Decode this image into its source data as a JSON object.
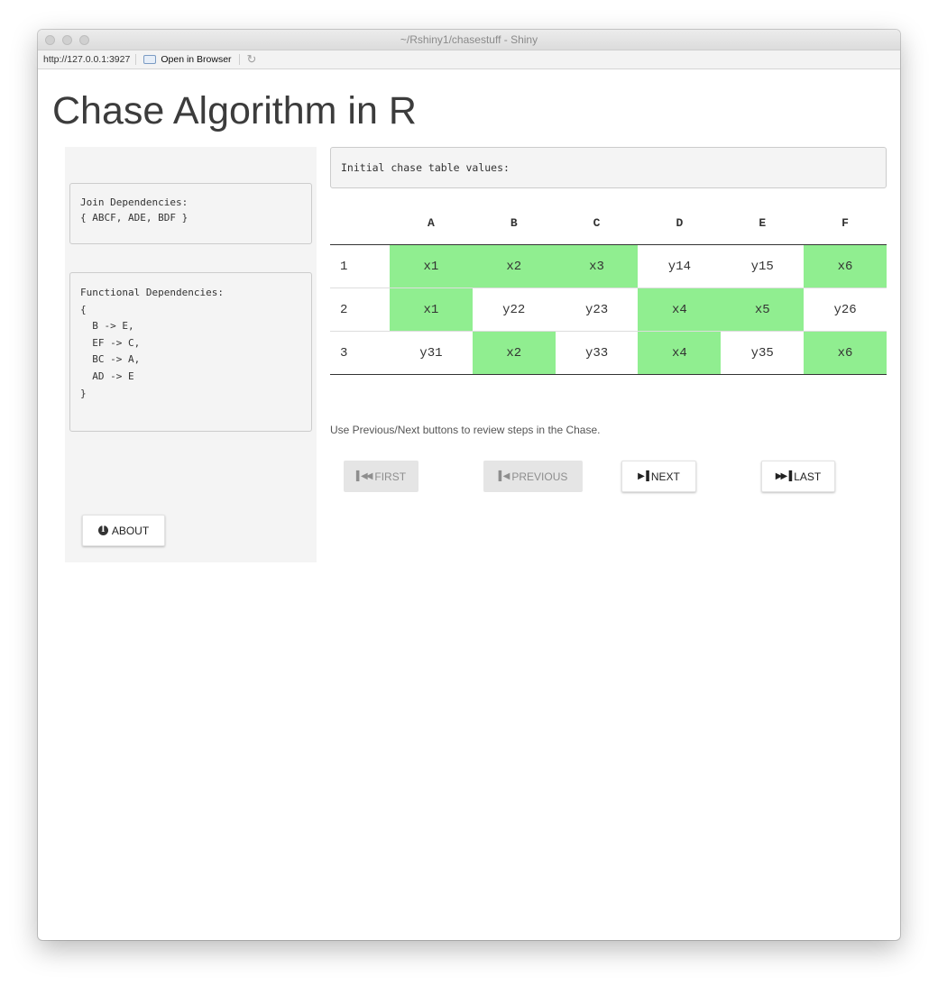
{
  "window": {
    "title": "~/Rshiny1/chasestuff - Shiny",
    "url": "http://127.0.0.1:3927",
    "open_in_browser": "Open in Browser"
  },
  "page": {
    "title": "Chase Algorithm in R"
  },
  "sidebar": {
    "join_dependencies": "Join Dependencies:\n{ ABCF, ADE, BDF }",
    "functional_dependencies": "Functional Dependencies:\n{\n  B -> E,\n  EF -> C,\n  BC -> A,\n  AD -> E\n}",
    "about_label": "ABOUT"
  },
  "main": {
    "status": "Initial chase table values:",
    "table": {
      "columns": [
        "",
        "A",
        "B",
        "C",
        "D",
        "E",
        "F"
      ],
      "rows": [
        {
          "id": "1",
          "cells": [
            "x1",
            "x2",
            "x3",
            "y14",
            "y15",
            "x6"
          ],
          "highlight": [
            true,
            true,
            true,
            false,
            false,
            true
          ]
        },
        {
          "id": "2",
          "cells": [
            "x1",
            "y22",
            "y23",
            "x4",
            "x5",
            "y26"
          ],
          "highlight": [
            true,
            false,
            false,
            true,
            true,
            false
          ]
        },
        {
          "id": "3",
          "cells": [
            "y31",
            "x2",
            "y33",
            "x4",
            "y35",
            "x6"
          ],
          "highlight": [
            false,
            true,
            false,
            true,
            false,
            true
          ]
        }
      ],
      "highlight_color": "#90ee90"
    },
    "help_text": "Use Previous/Next buttons to review steps in the Chase.",
    "buttons": {
      "first": "FIRST",
      "previous": "PREVIOUS",
      "next": "NEXT",
      "last": "LAST"
    }
  }
}
